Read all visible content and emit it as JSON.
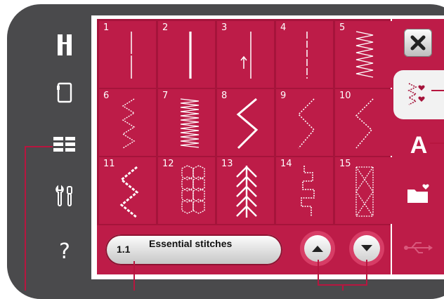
{
  "left_panel": {
    "icons": [
      "presser-foot-icon",
      "bobbin-icon",
      "menu-grid-icon",
      "settings-tools-icon",
      "help-icon"
    ],
    "help_symbol": "?"
  },
  "stitch_grid": {
    "stitches": [
      {
        "number": "1",
        "pattern": "straight-center"
      },
      {
        "number": "2",
        "pattern": "straight-triple"
      },
      {
        "number": "3",
        "pattern": "straight-reverse"
      },
      {
        "number": "4",
        "pattern": "straight-basting"
      },
      {
        "number": "5",
        "pattern": "zigzag-dense"
      },
      {
        "number": "6",
        "pattern": "zigzag-three-step"
      },
      {
        "number": "7",
        "pattern": "zigzag-satin"
      },
      {
        "number": "8",
        "pattern": "zigzag-wide"
      },
      {
        "number": "9",
        "pattern": "zigzag-dotted"
      },
      {
        "number": "10",
        "pattern": "zigzag-dotted-wide"
      },
      {
        "number": "11",
        "pattern": "zigzag-bold-dotted"
      },
      {
        "number": "12",
        "pattern": "honeycomb"
      },
      {
        "number": "13",
        "pattern": "feather"
      },
      {
        "number": "14",
        "pattern": "stepped"
      },
      {
        "number": "15",
        "pattern": "cross-stitch"
      }
    ]
  },
  "category": {
    "code": "1.1",
    "name": "Essential stitches"
  },
  "nav": {
    "up_icon": "arrow-up-icon",
    "down_icon": "arrow-down-icon"
  },
  "right_tabs": {
    "close_icon": "close-icon",
    "tabs": [
      "stitch-menu-icon",
      "font-menu-icon",
      "file-manager-icon",
      "usb-icon"
    ],
    "font_letter": "A",
    "selected": "stitch-menu-icon"
  },
  "colors": {
    "accent": "#bd1c48",
    "accent_dark": "#a5143b",
    "bezel": "#4a4a4c"
  }
}
